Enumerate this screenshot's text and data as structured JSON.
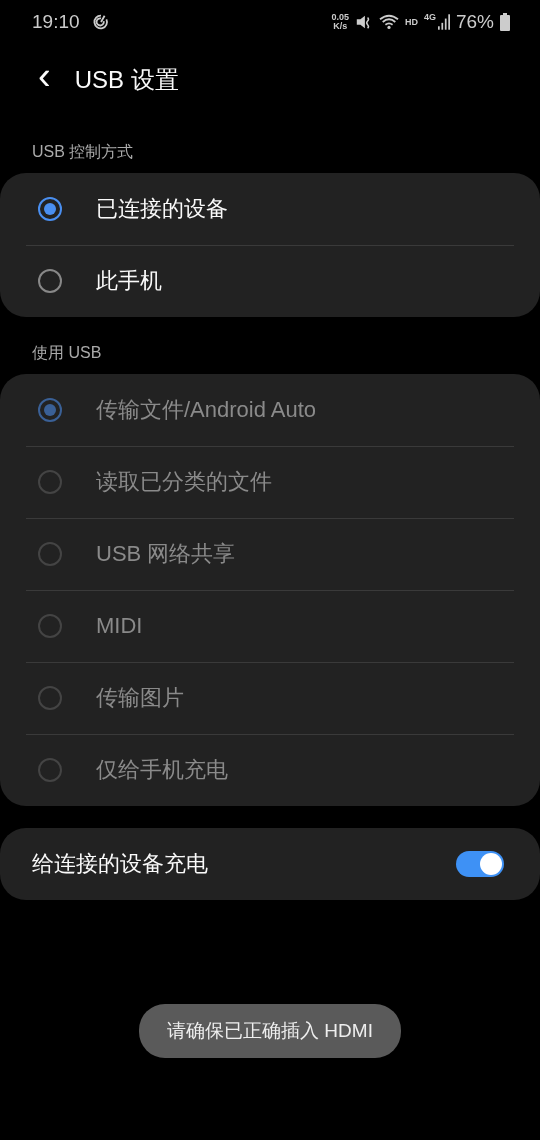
{
  "status_bar": {
    "time": "19:10",
    "net_speed": [
      "0.05",
      "K/s"
    ],
    "hd": "HD",
    "network": "4G",
    "battery": "76%"
  },
  "header": {
    "back": "‹",
    "title": "USB 设置"
  },
  "sections": [
    {
      "label": "USB 控制方式",
      "disabled": false,
      "options": [
        {
          "label": "已连接的设备",
          "selected": true
        },
        {
          "label": "此手机",
          "selected": false
        }
      ]
    },
    {
      "label": "使用 USB",
      "disabled": true,
      "options": [
        {
          "label": "传输文件/Android Auto",
          "selected": true
        },
        {
          "label": "读取已分类的文件",
          "selected": false
        },
        {
          "label": "USB 网络共享",
          "selected": false
        },
        {
          "label": "MIDI",
          "selected": false
        },
        {
          "label": "传输图片",
          "selected": false
        },
        {
          "label": "仅给手机充电",
          "selected": false
        }
      ]
    }
  ],
  "toggle": {
    "label": "给连接的设备充电",
    "on": true
  },
  "toast": "请确保已正确插入 HDMI"
}
